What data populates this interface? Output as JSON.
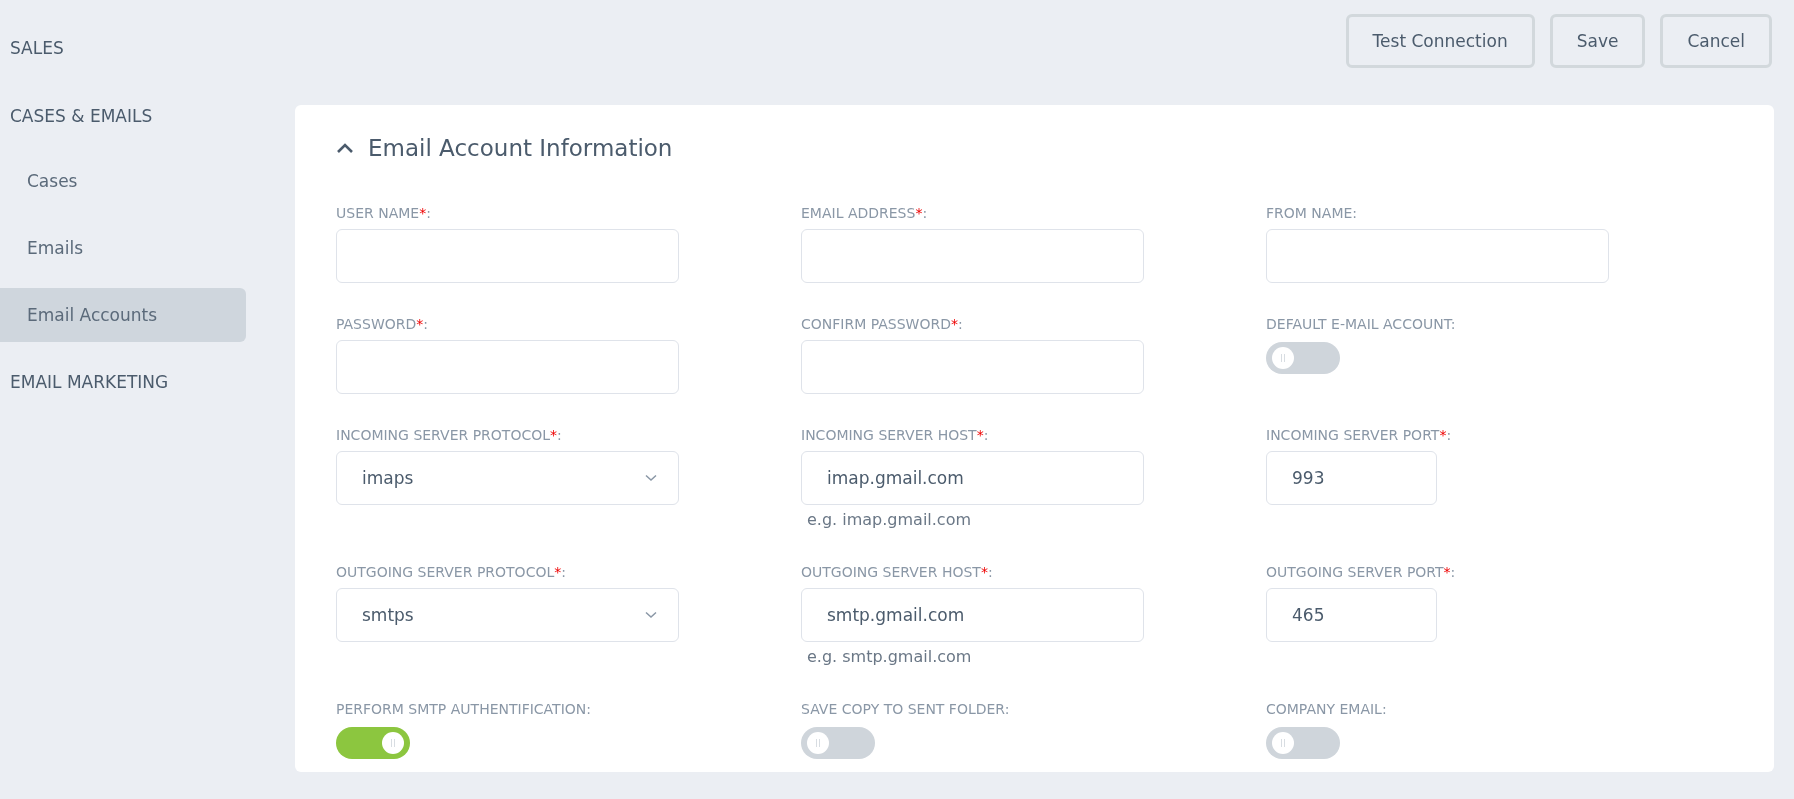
{
  "sidebar": {
    "sections": [
      {
        "title": "SALES"
      },
      {
        "title": "CASES & EMAILS",
        "items": [
          {
            "label": "Cases",
            "selected": false
          },
          {
            "label": "Emails",
            "selected": false
          },
          {
            "label": "Email Accounts",
            "selected": true
          }
        ]
      },
      {
        "title": "EMAIL MARKETING"
      }
    ]
  },
  "toolbar": {
    "buttons": [
      "Test Connection",
      "Save",
      "Cancel"
    ]
  },
  "panel": {
    "title": "Email Account Information",
    "expanded": true,
    "fields": [
      {
        "kind": "text",
        "label": "USER NAME",
        "required_mark": "*",
        "colon": ":"
      },
      {
        "kind": "text",
        "label": "EMAIL ADDRESS",
        "required_mark": "*",
        "colon": ":"
      },
      {
        "kind": "text",
        "label": "FROM NAME",
        "colon": ":"
      },
      {
        "kind": "text",
        "label": "PASSWORD",
        "required_mark": "*",
        "colon": ":"
      },
      {
        "kind": "text",
        "label": "CONFIRM PASSWORD",
        "required_mark": "*",
        "colon": ":"
      },
      {
        "kind": "toggle",
        "label": "DEFAULT E-MAIL ACCOUNT",
        "colon": ":",
        "on": false
      },
      {
        "kind": "select",
        "label": "INCOMING SERVER PROTOCOL",
        "required_mark": "*",
        "colon": ":",
        "value": "imaps"
      },
      {
        "kind": "text",
        "label": "INCOMING SERVER HOST",
        "required_mark": "*",
        "colon": ":",
        "value": "imap.gmail.com",
        "hint": "e.g. imap.gmail.com"
      },
      {
        "kind": "short",
        "label": "INCOMING SERVER PORT",
        "required_mark": "*",
        "colon": ":",
        "value": "993"
      },
      {
        "kind": "select",
        "label": "OUTGOING SERVER PROTOCOL",
        "required_mark": "*",
        "colon": ":",
        "value": "smtps"
      },
      {
        "kind": "text",
        "label": "OUTGOING SERVER HOST",
        "required_mark": "*",
        "colon": ":",
        "value": "smtp.gmail.com",
        "hint": "e.g. smtp.gmail.com"
      },
      {
        "kind": "short",
        "label": "OUTGOING SERVER PORT",
        "required_mark": "*",
        "colon": ":",
        "value": "465"
      },
      {
        "kind": "toggle",
        "label": "PERFORM SMTP AUTHENTIFICATION",
        "colon": ":",
        "on": true
      },
      {
        "kind": "toggle",
        "label": "SAVE COPY TO SENT FOLDER",
        "colon": ":",
        "on": false
      },
      {
        "kind": "toggle",
        "label": "COMPANY EMAIL",
        "colon": ":",
        "on": false
      }
    ]
  }
}
